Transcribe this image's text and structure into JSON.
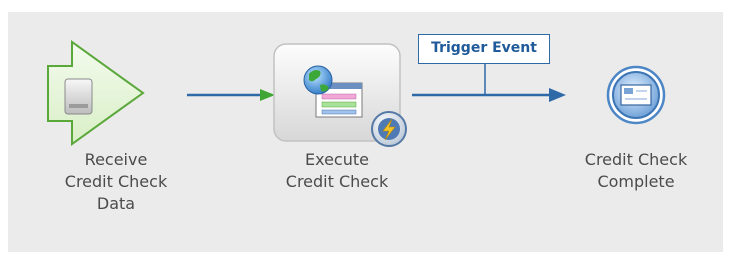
{
  "nodes": {
    "receive": {
      "lines": [
        "Receive",
        "Credit Check",
        "Data"
      ]
    },
    "execute": {
      "lines": [
        "Execute",
        "Credit Check"
      ]
    },
    "complete": {
      "lines": [
        "Credit Check",
        "Complete"
      ]
    }
  },
  "trigger": {
    "label": "Trigger Event"
  },
  "colors": {
    "background": "#ebebeb",
    "connector": "#2f6aa8",
    "start_arrow_head": "#3fa535",
    "start_shape_border": "#5aa83a",
    "start_shape_fill": "#dff3cf",
    "text": "#4b4b4b"
  },
  "icons": {
    "receive": "start-event-arrow-icon",
    "execute": "globe-form-task-icon",
    "execute_badge": "lightning-bolt-icon",
    "complete": "envelope-end-event-icon"
  }
}
